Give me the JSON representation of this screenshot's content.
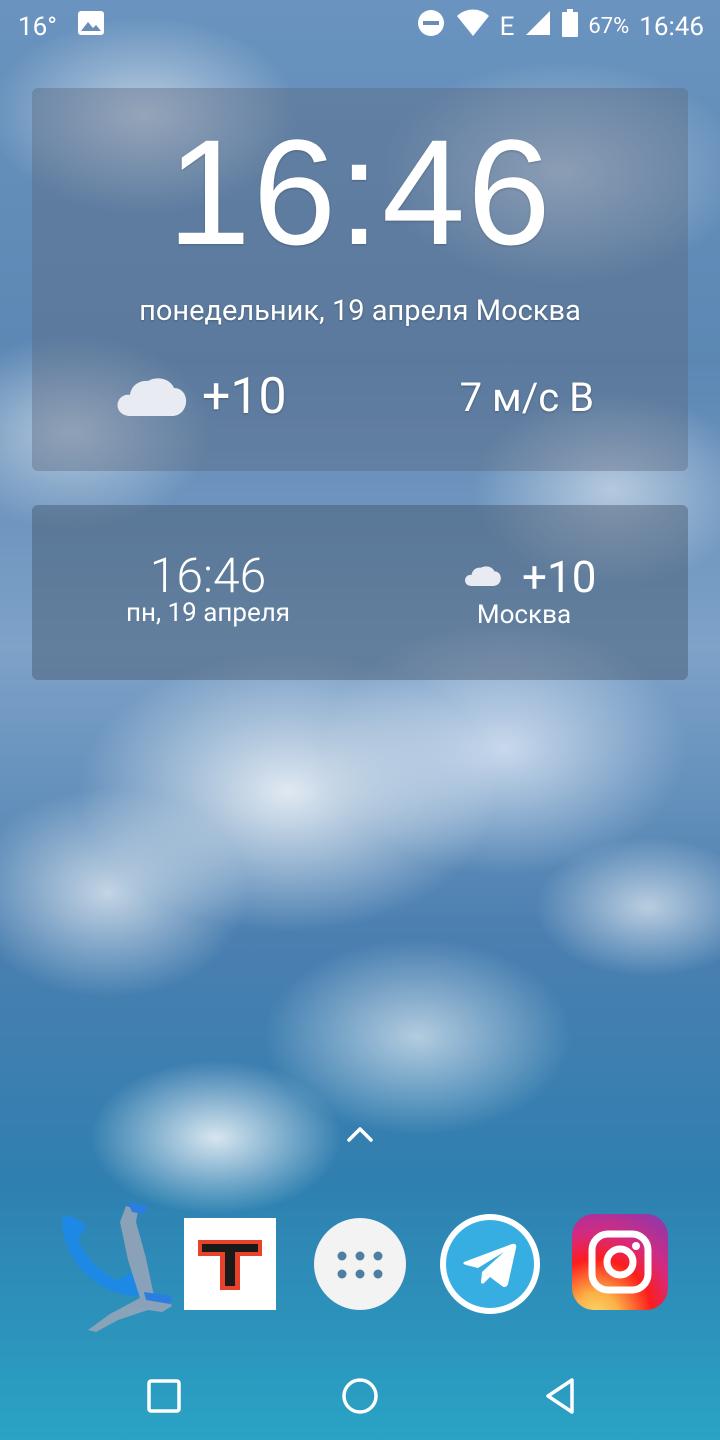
{
  "status_bar": {
    "temperature": "16°",
    "battery_percent": "67%",
    "network_type": "E",
    "time": "16:46",
    "icons": [
      "image-icon",
      "do-not-disturb-icon",
      "wifi-icon",
      "signal-icon",
      "battery-icon"
    ]
  },
  "clock_widget_large": {
    "time": "16:46",
    "date_city": "понедельник, 19 апреля  Москва",
    "weather_icon": "cloud-icon",
    "temperature": "+10",
    "wind": "7 м/с В"
  },
  "clock_widget_small": {
    "time": "16:46",
    "date": "пн, 19 апреля",
    "weather_icon": "cloud-icon",
    "temperature": "+10",
    "city": "Москва"
  },
  "dock": {
    "apps": [
      "phone-app",
      "t-news-app",
      "app-drawer",
      "telegram-app",
      "instagram-app"
    ],
    "t_letter": "T"
  },
  "colors": {
    "widget_overlay": "#5a6478",
    "telegram_blue": "#37aee2",
    "phone_blue": "#1e88e5",
    "t_logo_red": "#e8412c"
  }
}
